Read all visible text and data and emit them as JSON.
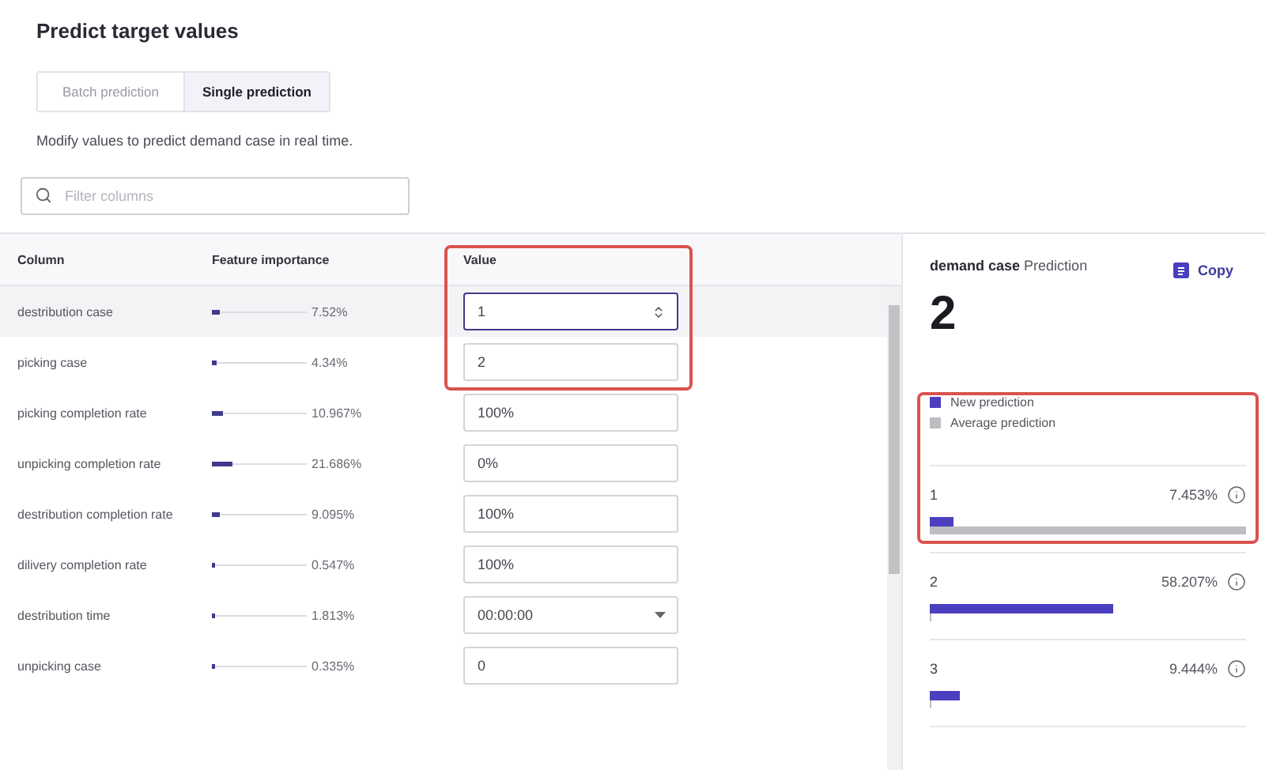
{
  "page": {
    "title": "Predict target values"
  },
  "tabs": [
    {
      "label": "Batch prediction",
      "selected": false
    },
    {
      "label": "Single prediction",
      "selected": true
    }
  ],
  "description": "Modify values to predict demand case in real time.",
  "search": {
    "placeholder": "Filter columns"
  },
  "table": {
    "columns": [
      "Column",
      "Feature importance",
      "Value"
    ],
    "highlight_value_column": true,
    "rows": [
      {
        "name": "destribution case",
        "importance": "7.52%",
        "level": 0.0752,
        "kind": "number",
        "value": "1",
        "selected": true
      },
      {
        "name": "picking case",
        "importance": "4.34%",
        "level": 0.0434,
        "kind": "text",
        "value": "2",
        "selected": false
      },
      {
        "name": "picking completion rate",
        "importance": "10.967%",
        "level": 0.10967,
        "kind": "text",
        "value": "100%",
        "selected": false
      },
      {
        "name": "unpicking completion rate",
        "importance": "21.686%",
        "level": 0.21686,
        "kind": "text",
        "value": "0%",
        "selected": false
      },
      {
        "name": "destribution completion rate",
        "importance": "9.095%",
        "level": 0.09095,
        "kind": "text",
        "value": "100%",
        "selected": false
      },
      {
        "name": "dilivery completion rate",
        "importance": "0.547%",
        "level": 0.00547,
        "kind": "text",
        "value": "100%",
        "selected": false
      },
      {
        "name": "destribution time",
        "importance": "1.813%",
        "level": 0.01813,
        "kind": "time",
        "value": "00:00:00",
        "selected": false
      },
      {
        "name": "unpicking case",
        "importance": "0.335%",
        "level": 0.00335,
        "kind": "text",
        "value": "0",
        "selected": false
      }
    ]
  },
  "prediction": {
    "target": "demand case",
    "label": "Prediction",
    "copy": "Copy",
    "value": "2",
    "highlight_first": true,
    "legend": [
      {
        "label": "New prediction",
        "color": "#4b3fc0"
      },
      {
        "label": "Average prediction",
        "color": "#bdbdc2"
      }
    ],
    "classes": [
      {
        "label": "1",
        "percent": "7.453%",
        "bars": [
          {
            "kind": "new",
            "level": 0.07453
          },
          {
            "kind": "average",
            "level": 1
          }
        ]
      },
      {
        "label": "2",
        "percent": "58.207%",
        "bars": [
          {
            "kind": "new",
            "level": 0.58207
          },
          {
            "kind": "average",
            "level": 0.005
          }
        ]
      },
      {
        "label": "3",
        "percent": "9.444%",
        "bars": [
          {
            "kind": "new",
            "level": 0.09444
          },
          {
            "kind": "average",
            "level": 0.005
          }
        ]
      }
    ]
  }
}
